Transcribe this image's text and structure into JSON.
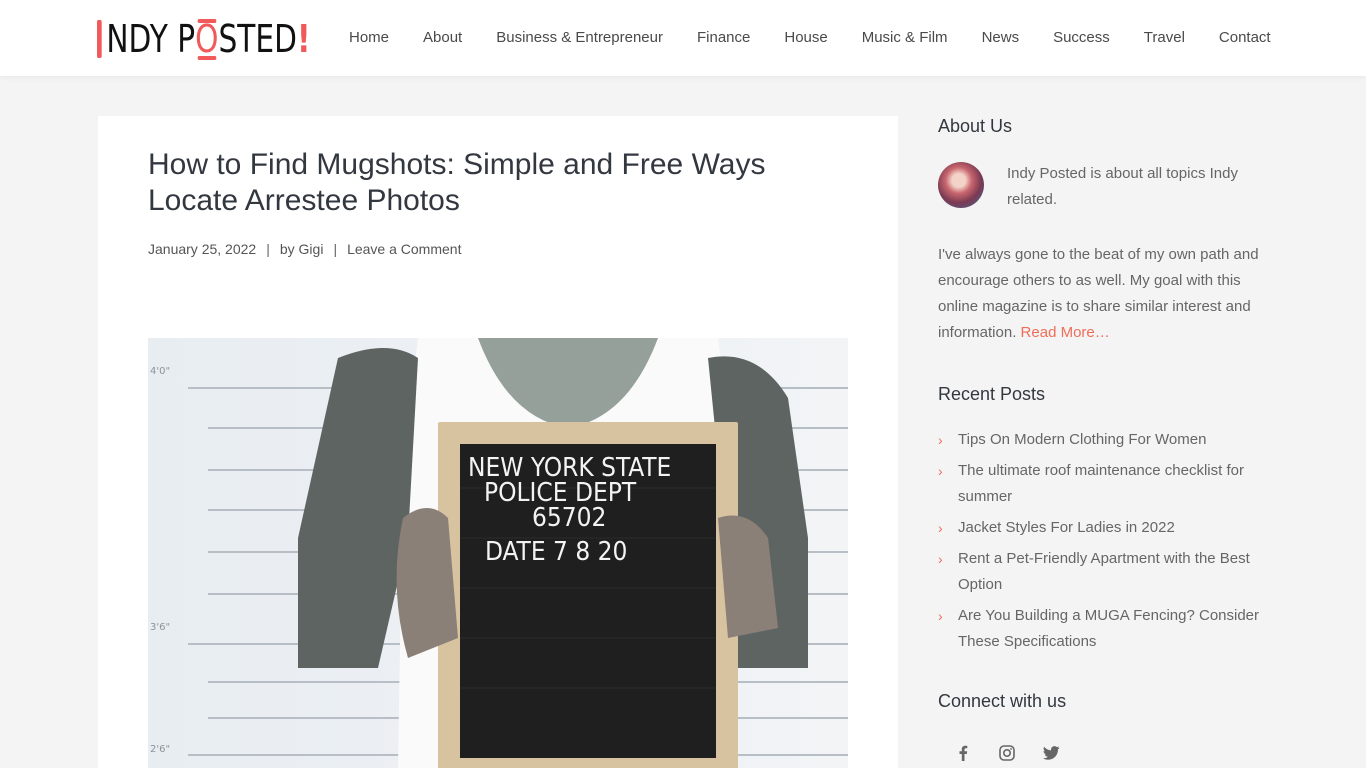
{
  "site": {
    "logo_text_1": "NDY P",
    "logo_o": "O",
    "logo_text_2": "STED",
    "logo_bang": "!",
    "accent_color": "#f05a5a"
  },
  "nav": {
    "items": [
      {
        "label": "Home"
      },
      {
        "label": "About"
      },
      {
        "label": "Business & Entrepreneur"
      },
      {
        "label": "Finance"
      },
      {
        "label": "House"
      },
      {
        "label": "Music & Film"
      },
      {
        "label": "News"
      },
      {
        "label": "Success"
      },
      {
        "label": "Travel"
      },
      {
        "label": "Contact"
      }
    ]
  },
  "post": {
    "title": "How to Find Mugshots: Simple and Free Ways Locate Arrestee Photos",
    "date": "January 25, 2022",
    "separator": "|",
    "by_prefix": "by",
    "author": "Gigi",
    "comment_link": "Leave a Comment",
    "image": {
      "description": "tattooed-man-holding-mugshot-letterboard",
      "sign_lines": [
        "NEW YORK STATE",
        "POLICE DEPT",
        "65702",
        "DATE 7 8 20"
      ],
      "height_marks": [
        "4'0\"",
        "3'6\"",
        "2'6\""
      ]
    }
  },
  "sidebar": {
    "about": {
      "title": "About Us",
      "short": "Indy Posted is about all topics Indy related.",
      "long": "I've always gone to the beat of my own path and encourage others to as well. My goal with this online magazine is to share similar interest and information.",
      "read_more": "Read More…"
    },
    "recent": {
      "title": "Recent Posts",
      "items": [
        {
          "label": "Tips On Modern Clothing For Women"
        },
        {
          "label": "The ultimate roof maintenance checklist for summer"
        },
        {
          "label": "Jacket Styles For Ladies in 2022"
        },
        {
          "label": "Rent a Pet-Friendly Apartment with the Best Option"
        },
        {
          "label": "Are You Building a MUGA Fencing? Consider These Specifications"
        }
      ]
    },
    "connect": {
      "title": "Connect with us",
      "icons": [
        "facebook-icon",
        "instagram-icon",
        "twitter-icon"
      ]
    }
  }
}
